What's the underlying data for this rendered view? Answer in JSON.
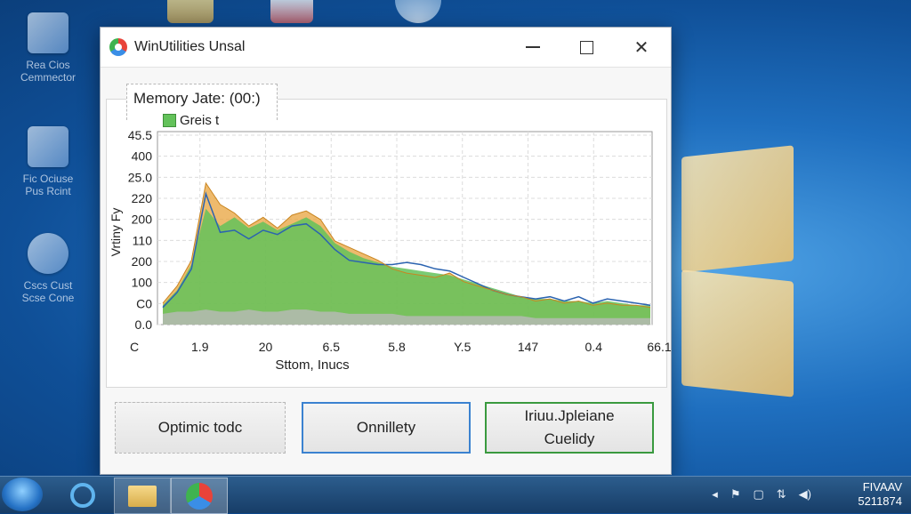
{
  "desktop": {
    "icons": [
      {
        "label": "Rea Cios Cemmector",
        "icon": "recycle-bin-icon"
      },
      {
        "label": "Fic Ociuse Pus Rcint",
        "icon": "network-icon"
      },
      {
        "label": "Cscs Cust Scse Cone",
        "icon": "disk-icon"
      }
    ]
  },
  "window": {
    "title": "WinUtilities Unsal",
    "controls": {
      "minimize": "minimize-icon",
      "maximize": "maximize-icon",
      "close": "✕"
    }
  },
  "chart": {
    "title": "Memory Jate: (00:)",
    "legend": "Greis t",
    "ylabel": "Vrtiny Fy",
    "xlabel": "Sttom, Inucs",
    "yticks": [
      "45.5",
      "400",
      "25.0",
      "220",
      "200",
      "110",
      "200",
      "100",
      "C0",
      "0.0"
    ],
    "xticks": [
      "C",
      "1.9",
      "20",
      "6.5",
      "5.8",
      "Y.5",
      "147",
      "0.4",
      "66.1"
    ]
  },
  "chart_data": {
    "type": "area",
    "title": "Memory Jate: (00:)",
    "xlabel": "Sttom, Inucs",
    "ylabel": "Vrtiny Fy",
    "grid": true,
    "legend_position": "top-left",
    "colors": {
      "green": "#63c25a",
      "orange": "#e8a33c",
      "blue": "#2b63b0",
      "gray": "#b9b9b9"
    },
    "series": [
      {
        "name": "Greis t",
        "values": [
          0.9,
          1.6,
          2.8,
          5.4,
          4.6,
          5.0,
          4.5,
          4.8,
          4.4,
          4.7,
          5.0,
          4.6,
          3.8,
          3.4,
          3.1,
          2.9,
          2.7,
          2.6,
          2.5,
          2.4,
          2.3,
          2.1,
          1.9,
          1.7,
          1.5,
          1.3,
          1.2,
          1.2,
          1.1,
          1.1,
          1.0,
          1.1,
          1.0,
          0.9,
          0.9
        ]
      },
      {
        "values": [
          1.0,
          1.8,
          3.0,
          6.6,
          5.6,
          5.2,
          4.6,
          5.0,
          4.5,
          5.1,
          5.3,
          4.9,
          3.9,
          3.6,
          3.3,
          3.0,
          2.6,
          2.4,
          2.3,
          2.2,
          2.4,
          2.0,
          1.8,
          1.6,
          1.4,
          1.3,
          1.1,
          1.2,
          1.0,
          1.1,
          0.9,
          1.0,
          0.9,
          0.9,
          0.8
        ]
      },
      {
        "values": [
          0.8,
          1.5,
          2.6,
          6.1,
          4.3,
          4.4,
          4.0,
          4.4,
          4.2,
          4.6,
          4.7,
          4.2,
          3.5,
          3.0,
          2.9,
          2.8,
          2.8,
          2.9,
          2.8,
          2.6,
          2.5,
          2.2,
          1.9,
          1.6,
          1.4,
          1.3,
          1.2,
          1.3,
          1.1,
          1.3,
          1.0,
          1.2,
          1.1,
          1.0,
          0.9
        ]
      },
      {
        "values": [
          0.5,
          0.6,
          0.6,
          0.7,
          0.6,
          0.6,
          0.7,
          0.6,
          0.6,
          0.7,
          0.7,
          0.6,
          0.6,
          0.5,
          0.5,
          0.5,
          0.5,
          0.4,
          0.4,
          0.4,
          0.4,
          0.4,
          0.4,
          0.4,
          0.4,
          0.4,
          0.3,
          0.3,
          0.3,
          0.3,
          0.3,
          0.3,
          0.3,
          0.3,
          0.3
        ]
      }
    ],
    "ylim": [
      0,
      9
    ]
  },
  "buttons": {
    "b1": "Optimic todc",
    "b2": "Onnillety",
    "b3_line1": "Iriuu.Jpleiane",
    "b3_line2": "Cuelidy"
  },
  "taskbar": {
    "clock_line1": "FIVAAV",
    "clock_line2": "5211874"
  }
}
